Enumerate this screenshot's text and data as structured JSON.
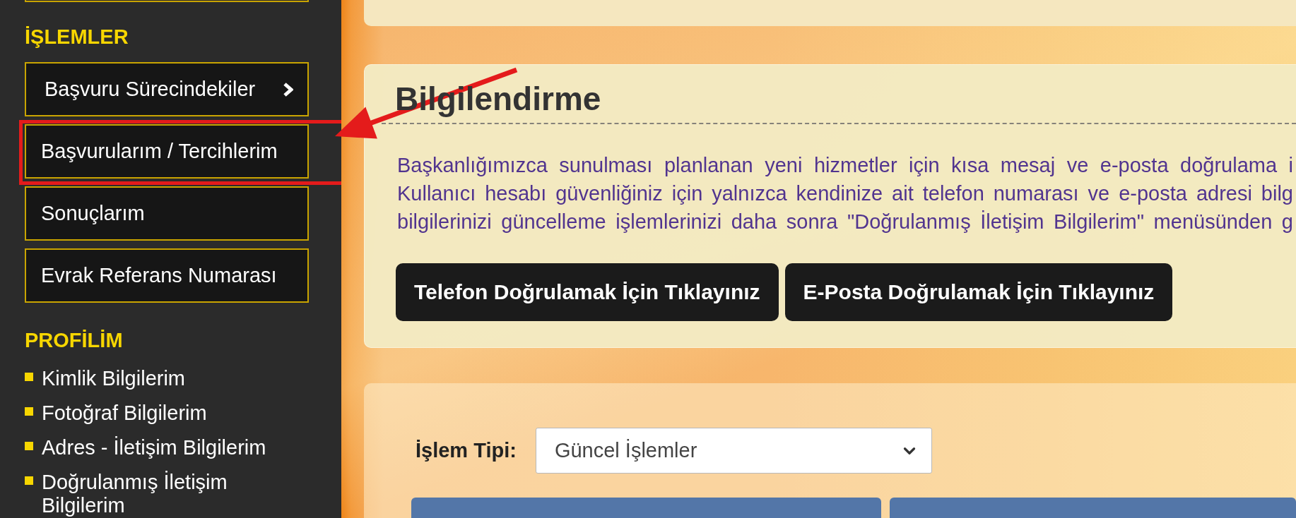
{
  "sidebar": {
    "sections": [
      {
        "title": "İŞLEMLER",
        "kind": "boxed",
        "items": [
          {
            "label": "Başvuru Sürecindekiler",
            "submenu": true,
            "highlighted": false
          },
          {
            "label": "Başvurularım / Tercihlerim",
            "submenu": false,
            "highlighted": true
          },
          {
            "label": "Sonuçlarım",
            "submenu": false,
            "highlighted": false
          },
          {
            "label": "Evrak Referans Numarası",
            "submenu": false,
            "highlighted": false
          }
        ]
      },
      {
        "title": "PROFİLİM",
        "kind": "bulleted",
        "items": [
          {
            "label": "Kimlik Bilgilerim"
          },
          {
            "label": "Fotoğraf Bilgilerim"
          },
          {
            "label": "Adres - İletişim Bilgilerim"
          },
          {
            "label": "Doğrulanmış İletişim Bilgilerim"
          }
        ]
      }
    ]
  },
  "info_panel": {
    "title": "Bilgilendirme",
    "paragraph_lines": [
      "Başkanlığımızca sunulması planlanan yeni hizmetler için kısa mesaj ve e-posta doğrulama i",
      "Kullanıcı hesabı güvenliğiniz için yalnızca kendinize ait telefon numarası ve e-posta adresi bilg",
      "bilgilerinizi güncelleme işlemlerinizi daha sonra \"Doğrulanmış İletişim Bilgilerim\" menüsünden g"
    ],
    "buttons": [
      "Telefon Doğrulamak İçin Tıklayınız",
      "E-Posta Doğrulamak İçin Tıklayınız"
    ]
  },
  "filter_panel": {
    "label": "İşlem Tipi:",
    "select": {
      "value": "Güncel İşlemler"
    }
  }
}
